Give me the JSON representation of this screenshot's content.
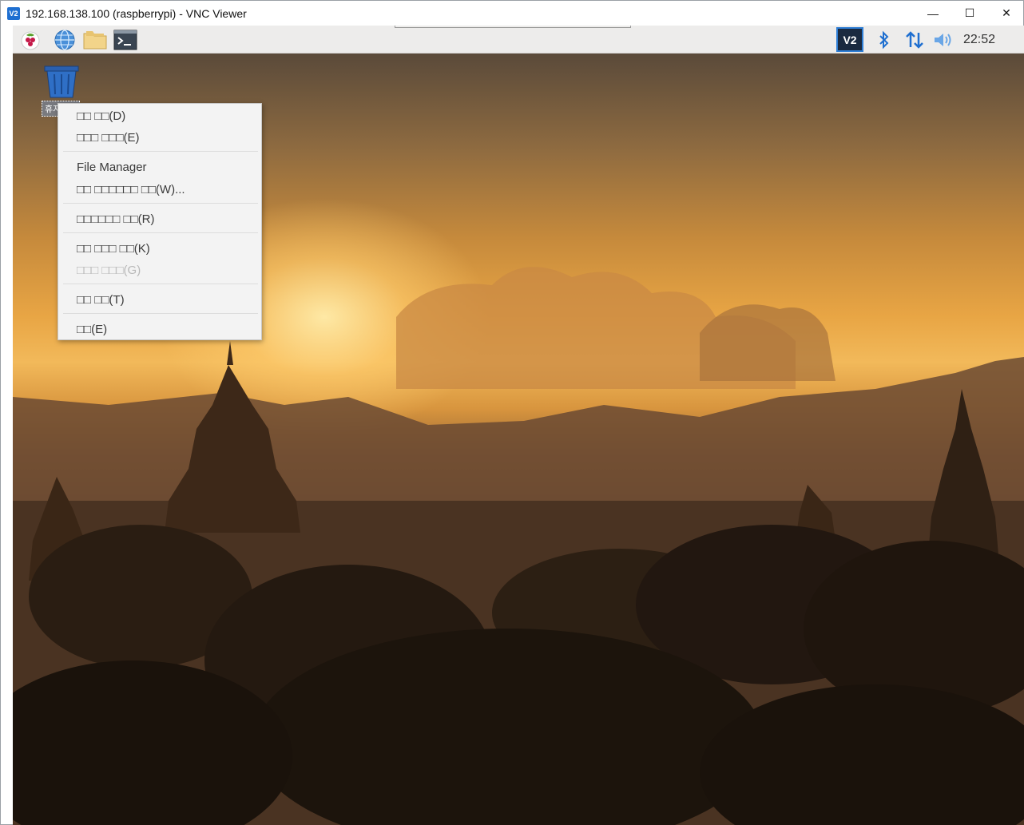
{
  "window": {
    "title": "192.168.138.100 (raspberrypi) - VNC Viewer",
    "app_icon_label": "V2",
    "minimize_glyph": "—",
    "maximize_glyph": "☐",
    "close_glyph": "✕"
  },
  "panel": {
    "launchers": [
      {
        "name": "raspberry-menu-icon"
      },
      {
        "name": "web-browser-icon"
      },
      {
        "name": "file-manager-icon"
      },
      {
        "name": "terminal-icon"
      }
    ],
    "tray": {
      "vnc_label": "V2",
      "clock": "22:52"
    }
  },
  "desktop": {
    "trash_label": "휴지통"
  },
  "context_menu": {
    "items": [
      {
        "label": "□□ □□(D)",
        "disabled": false
      },
      {
        "label": "□□□ □□□(E)",
        "disabled": false
      },
      {
        "label": "File Manager",
        "disabled": false
      },
      {
        "label": "□□ □□□□□□ □□(W)...",
        "disabled": false
      },
      {
        "label": "□□□□□□ □□(R)",
        "disabled": false
      },
      {
        "label": "□□ □□□ □□(K)",
        "disabled": false
      },
      {
        "label": "□□□ □□□(G)",
        "disabled": true
      },
      {
        "label": "□□ □□(T)",
        "disabled": false
      },
      {
        "label": "□□(E)",
        "disabled": false
      }
    ]
  },
  "colors": {
    "panel_bg": "#edeceb",
    "vnc_accent": "#2f7fd6",
    "bluetooth_blue": "#1f6fd0",
    "menu_bg": "#f3f3f3"
  }
}
